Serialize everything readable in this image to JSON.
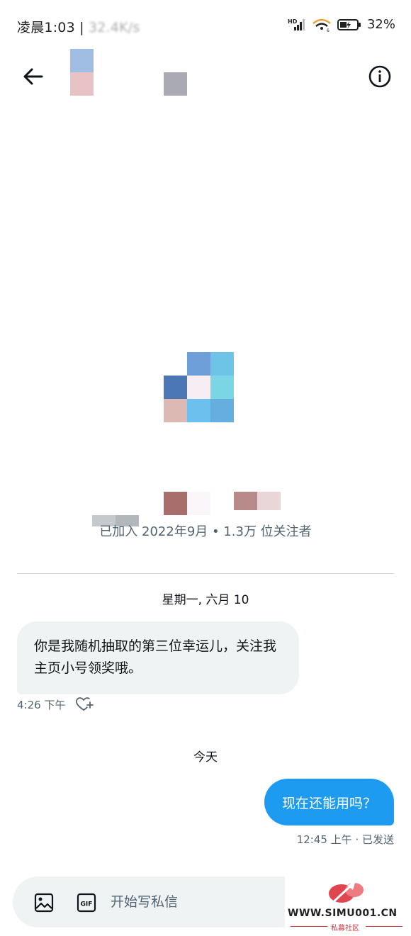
{
  "status_bar": {
    "time": "凌晨1:03",
    "separator": " | ",
    "net_speed": "32.4K/s",
    "battery": "32%"
  },
  "header": {
    "back_icon": "arrow-left-icon",
    "info_icon": "info-circle-icon"
  },
  "profile": {
    "meta": "已加入 2022年9月 • 1.3万 位关注者"
  },
  "conversation": {
    "date_separator_1": "星期一, 六月 10",
    "incoming_message": "你是我随机抽取的第三位幸运儿，关注我主页小号领奖哦。",
    "incoming_time": "4:26 下午",
    "date_separator_2": "今天",
    "outgoing_message": "现在还能用吗？",
    "outgoing_status": "12:45 上午 · 已发送"
  },
  "composer": {
    "placeholder": "开始写私信",
    "image_icon": "image-icon",
    "gif_icon": "gif-icon"
  },
  "watermark": {
    "text": "WWW.SIMU001.CN",
    "subtext": "私募社区"
  },
  "colors": {
    "accent": "#1d9bf0",
    "bubble_in": "#eff3f4",
    "secondary_text": "#536471"
  }
}
